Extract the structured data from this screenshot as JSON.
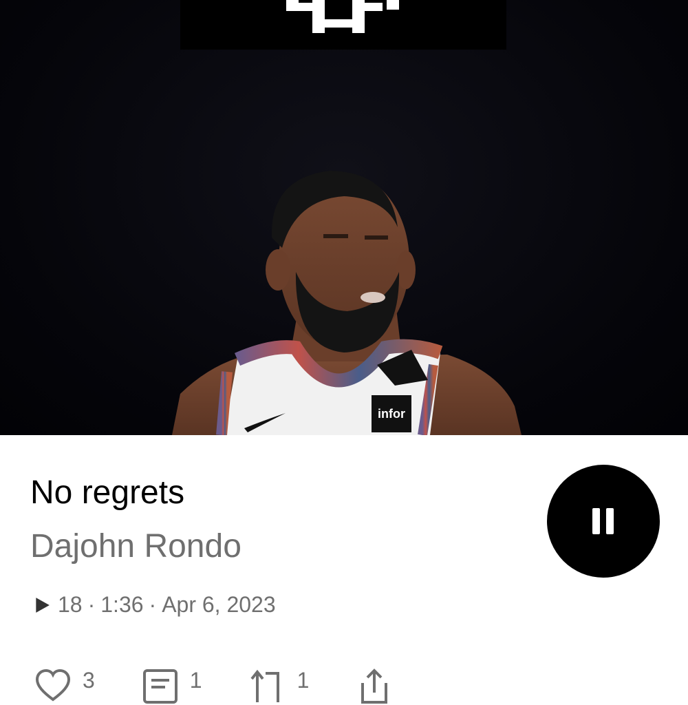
{
  "track": {
    "title": "No regrets",
    "artist": "Dajohn Rondo",
    "plays": "18",
    "duration": "1:36",
    "date": "Apr 6, 2023"
  },
  "artwork": {
    "jersey_patch": "infor"
  },
  "player": {
    "state_icon": "pause-icon"
  },
  "actions": {
    "likes": "3",
    "comments": "1",
    "reposts": "1"
  },
  "colors": {
    "primary_text": "#000000",
    "secondary_text": "#6f6f6f",
    "button_bg": "#000000"
  }
}
